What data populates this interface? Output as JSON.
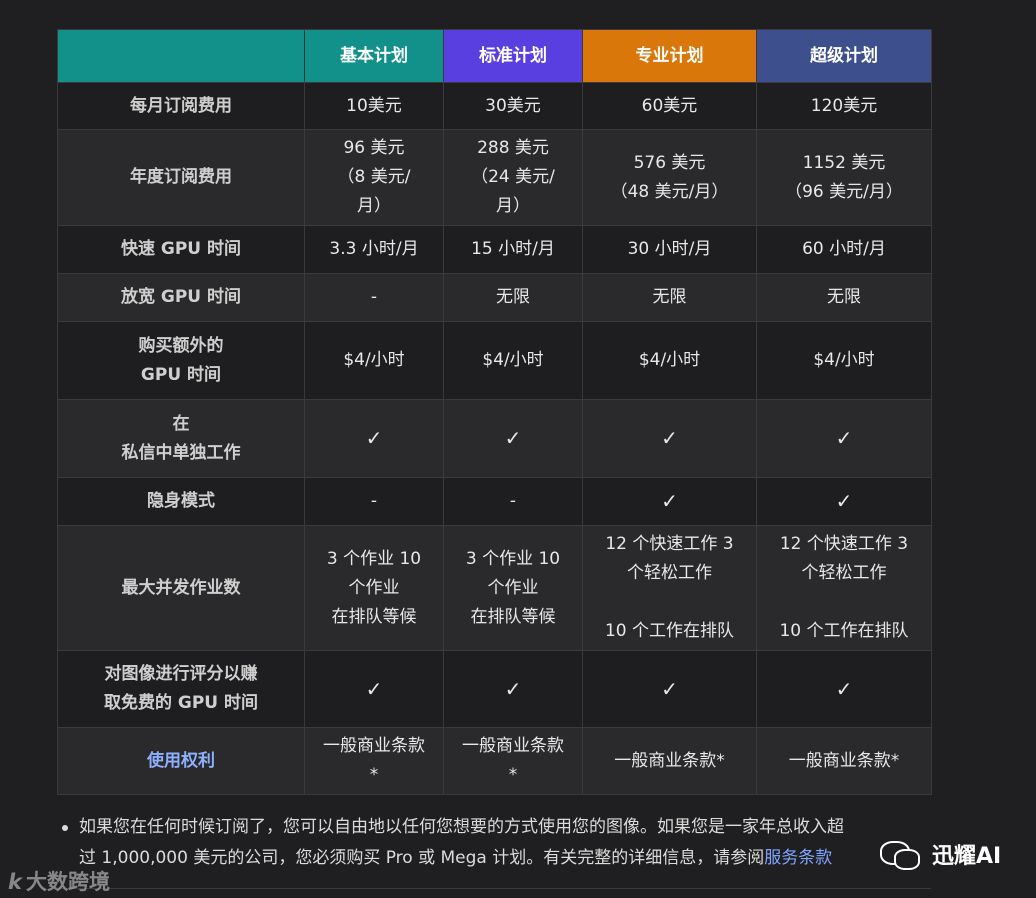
{
  "headers": [
    "",
    "基本计划",
    "标准计划",
    "专业计划",
    "超级计划"
  ],
  "rows": [
    {
      "label": [
        "每月订阅费用"
      ],
      "cells": [
        [
          "10美元"
        ],
        [
          "30美元"
        ],
        [
          "60美元"
        ],
        [
          "120美元"
        ]
      ]
    },
    {
      "label": [
        "年度订阅费用"
      ],
      "cells": [
        [
          "96 美元",
          "（8 美元/",
          "月）"
        ],
        [
          "288 美元",
          "（24 美元/",
          "月）"
        ],
        [
          "576 美元",
          "（48 美元/月）"
        ],
        [
          "1152 美元",
          "（96 美元/月）"
        ]
      ]
    },
    {
      "label": [
        "快速 GPU 时间"
      ],
      "cells": [
        [
          "3.3 小时/月"
        ],
        [
          "15 小时/月"
        ],
        [
          "30 小时/月"
        ],
        [
          "60 小时/月"
        ]
      ]
    },
    {
      "label": [
        "放宽 GPU 时间"
      ],
      "cells": [
        [
          "-"
        ],
        [
          "无限"
        ],
        [
          "无限"
        ],
        [
          "无限"
        ]
      ]
    },
    {
      "label": [
        "购买额外的",
        "GPU 时间"
      ],
      "cells": [
        [
          "$4/小时"
        ],
        [
          "$4/小时"
        ],
        [
          "$4/小时"
        ],
        [
          "$4/小时"
        ]
      ]
    },
    {
      "label": [
        "在",
        "私信中单独工作"
      ],
      "cells": [
        [
          "✓"
        ],
        [
          "✓"
        ],
        [
          "✓"
        ],
        [
          "✓"
        ]
      ]
    },
    {
      "label": [
        "隐身模式"
      ],
      "cells": [
        [
          "-"
        ],
        [
          "-"
        ],
        [
          "✓"
        ],
        [
          "✓"
        ]
      ]
    },
    {
      "label": [
        "最大并发作业数"
      ],
      "cells": [
        [
          "3 个作业 10",
          "个作业",
          "在排队等候"
        ],
        [
          "3 个作业 10",
          "个作业",
          "在排队等候"
        ],
        [
          "12 个快速工作 3",
          "个轻松工作",
          "",
          "10 个工作在排队"
        ],
        [
          "12 个快速工作 3",
          "个轻松工作",
          "",
          "10 个工作在排队"
        ]
      ]
    },
    {
      "label": [
        "对图像进行评分以赚",
        "取免费的 GPU 时间"
      ],
      "cells": [
        [
          "✓"
        ],
        [
          "✓"
        ],
        [
          "✓"
        ],
        [
          "✓"
        ]
      ]
    },
    {
      "label": [
        "使用权利"
      ],
      "link": true,
      "cells": [
        [
          "一般商业条款",
          "*"
        ],
        [
          "一般商业条款",
          "*"
        ],
        [
          "一般商业条款*"
        ],
        [
          "一般商业条款*"
        ]
      ]
    }
  ],
  "footnote": {
    "line1": "如果您在任何时候订阅了，您可以自由地以任何您想要的方式使用您的图像。如果您是一家年总收入超",
    "line2_prefix": "过 1,000,000 美元的公司，您必须购买 Pro 或 Mega 计划。有关完整的详细信息，请参阅",
    "link_text": "服务条款"
  },
  "watermark_left": {
    "logo": "k",
    "text": "大数跨境"
  },
  "watermark_right": {
    "text": "迅耀AI"
  },
  "colors": {
    "teal": "#12918a",
    "purple": "#5a3fe0",
    "orange": "#d9770b",
    "navy": "#3d4f8c",
    "link": "#8fb0ff"
  }
}
